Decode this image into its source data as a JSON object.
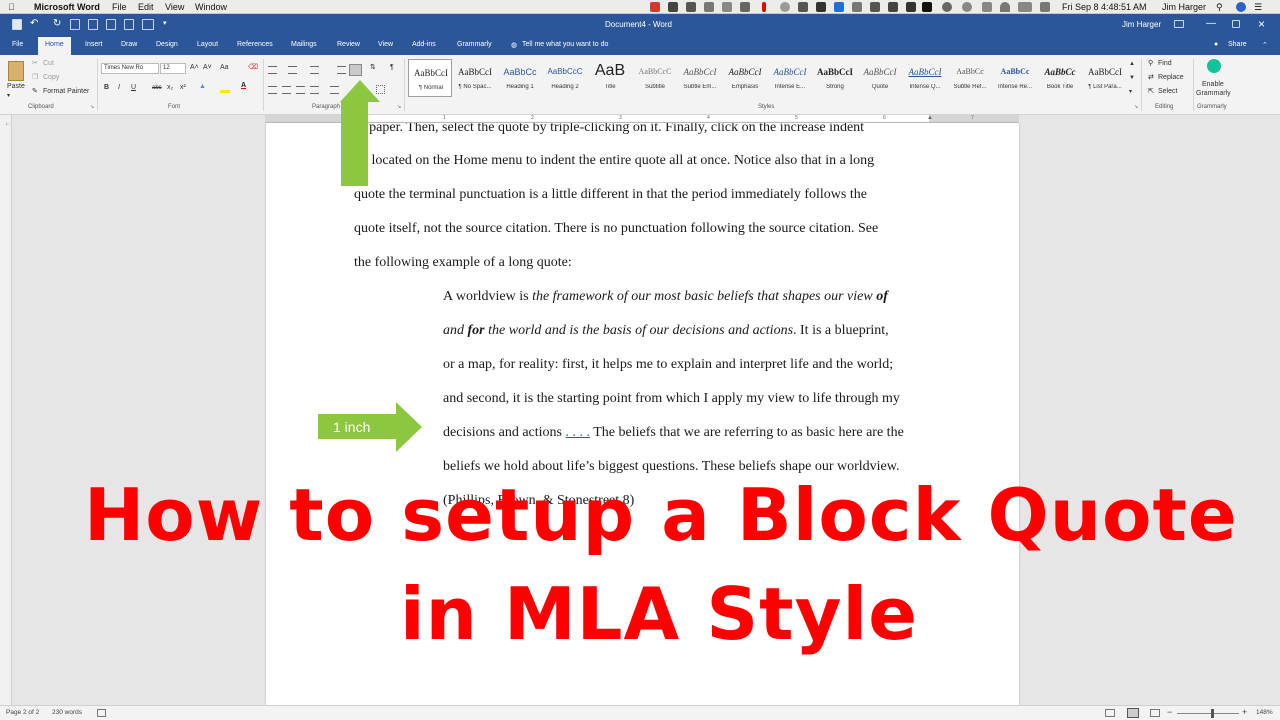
{
  "mac_menu": {
    "app": "Microsoft Word",
    "items": [
      "File",
      "Edit",
      "View",
      "Window"
    ],
    "clock": "Fri Sep 8  4:48:51 AM",
    "user": "Jim Harger"
  },
  "title": {
    "document": "Document4 - Word",
    "user": "Jim Harger"
  },
  "tabs": [
    "File",
    "Home",
    "Insert",
    "Draw",
    "Design",
    "Layout",
    "References",
    "Mailings",
    "Review",
    "View",
    "Add-ins",
    "Grammarly"
  ],
  "tell_me": "Tell me what you want to do",
  "share": "Share",
  "clipboard": {
    "paste": "Paste",
    "cut": "Cut",
    "copy": "Copy",
    "format_painter": "Format Painter",
    "label": "Clipboard"
  },
  "font": {
    "name": "Times New Ro",
    "size": "12",
    "label": "Font",
    "bold": "B",
    "italic": "I",
    "underline": "U",
    "strike": "abc",
    "sub": "x₂",
    "sup": "x²",
    "grow": "A˄",
    "shrink": "A˅",
    "case": "Aa",
    "color": "A"
  },
  "paragraph": {
    "label": "Paragraph",
    "pilcrow": "¶"
  },
  "styles": {
    "label": "Styles",
    "items": [
      {
        "sample": "AaBbCcI",
        "name": "¶ Normal"
      },
      {
        "sample": "AaBbCcI",
        "name": "¶ No Spac..."
      },
      {
        "sample": "AaBbCc",
        "name": "Heading 1"
      },
      {
        "sample": "AaBbCcC",
        "name": "Heading 2"
      },
      {
        "sample": "AaB",
        "name": "Title"
      },
      {
        "sample": "AaBbCcC",
        "name": "Subtitle"
      },
      {
        "sample": "AaBbCcI",
        "name": "Subtle Em..."
      },
      {
        "sample": "AaBbCcI",
        "name": "Emphasis"
      },
      {
        "sample": "AaBbCcI",
        "name": "Intense E..."
      },
      {
        "sample": "AaBbCcI",
        "name": "Strong"
      },
      {
        "sample": "AaBbCcI",
        "name": "Quote"
      },
      {
        "sample": "AaBbCcI",
        "name": "Intense Q..."
      },
      {
        "sample": "AaBbCc",
        "name": "Subtle Ref..."
      },
      {
        "sample": "AaBbCc",
        "name": "Intense Re..."
      },
      {
        "sample": "AaBbCc",
        "name": "Book Title"
      },
      {
        "sample": "AaBbCcI",
        "name": "¶ List Para..."
      }
    ]
  },
  "editing": {
    "find": "Find",
    "replace": "Replace",
    "select": "Select",
    "label": "Editing"
  },
  "grammarly": {
    "line1": "Enable",
    "line2": "Grammarly",
    "label": "Grammarly"
  },
  "document": {
    "intro_lines": [
      "ur paper.  Then, select the quote by triple-clicking on it.  Finally, click on the increase indent",
      "on located on the Home menu to indent the entire quote all at once.  Notice also that in a long",
      "quote the terminal punctuation is a little different in that the period immediately follows the",
      "quote itself, not the source citation.  There is no punctuation following the source citation.  See",
      "the following example of a long quote:"
    ],
    "quote": {
      "l1_plain": "A worldview is ",
      "l1_italic": "the framework of our most basic beliefs that shapes our view ",
      "l1_bold": "of",
      "l2_italic_a": "and ",
      "l2_bold": "for",
      "l2_italic_b": " the world and is the basis of our decisions and actions",
      "l2_plain": ".  It is a blueprint,",
      "l3": "or a map, for reality: first, it helps me to explain and interpret life and the world;",
      "l4": "and second, it is the starting point from which I apply my view to life through my",
      "l5_a": "decisions and actions ",
      "l5_dots": ". . . .",
      "l5_b": " The beliefs that we are referring to as basic here are the",
      "l6": "beliefs we hold about life’s biggest questions. These beliefs shape our worldview.",
      "l7": "(Phillips, Brown, & Stonestreet 8)"
    }
  },
  "annotation": {
    "inch_label": "1 inch",
    "arrow_color": "#8dc63f"
  },
  "overlay": {
    "line1": "How to setup a Block Quote",
    "line2": "in MLA Style",
    "color": "#ff0000"
  },
  "status": {
    "page": "Page 2 of 2",
    "words": "230 words",
    "zoom": "148%"
  },
  "colors": {
    "word_blue": "#2b579a",
    "ribbon_bg": "#f3f3f3"
  }
}
